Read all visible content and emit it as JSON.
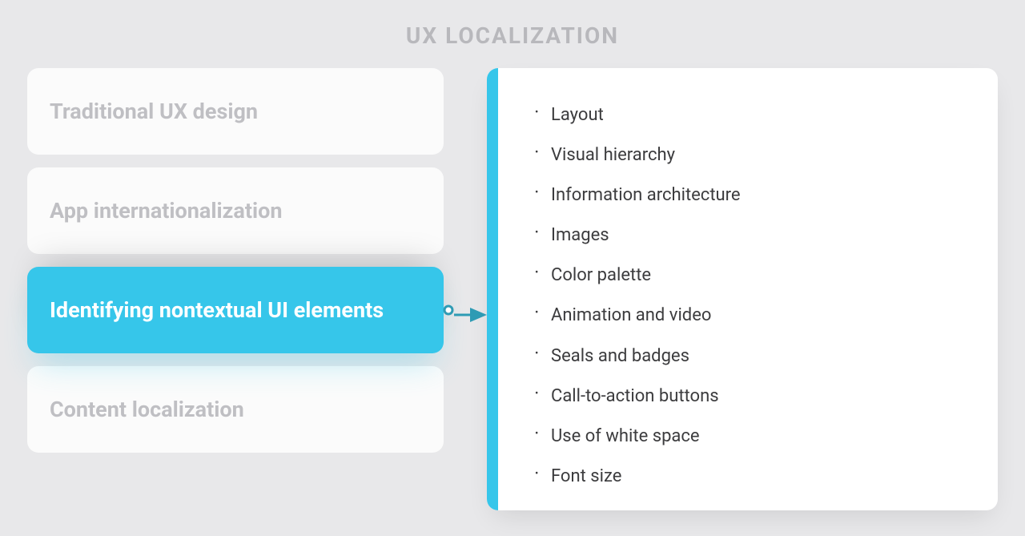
{
  "title": "UX LOCALIZATION",
  "cards": [
    {
      "label": "Traditional UX design"
    },
    {
      "label": "App internationalization"
    },
    {
      "label": "Identifying nontextual UI elements"
    },
    {
      "label": "Content localization"
    }
  ],
  "details": [
    "Layout",
    "Visual hierarchy",
    "Information architecture",
    "Images",
    "Color palette",
    "Animation and video",
    "Seals and badges",
    "Call-to-action buttons",
    "Use of white space",
    "Font size"
  ],
  "colors": {
    "accent": "#36c6ea",
    "muted_text": "#bfbfc3",
    "background": "#e8e8ea",
    "body_text": "#3c3c3e"
  }
}
